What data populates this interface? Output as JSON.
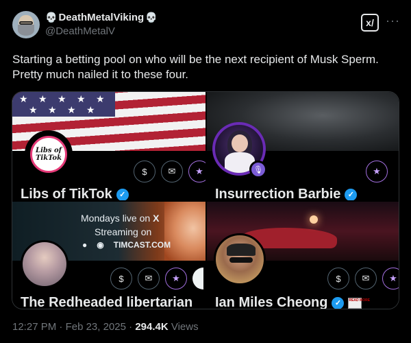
{
  "author": {
    "display_name": "DeathMetalViking",
    "handle": "@DeathMetalV",
    "skull_glyph": "💀"
  },
  "post": {
    "text": "Starting a betting pool on who will be the next recipient of Musk Sperm. Pretty much nailed it to these four."
  },
  "cards": [
    {
      "name": "Libs of TikTok",
      "pfp_text": "Libs of TikTok"
    },
    {
      "name": "Insurrection Barbie"
    },
    {
      "name": "The Redheaded libertarian",
      "banner_line1": "Mondays live on",
      "banner_x": "X",
      "banner_line2": "Streaming on",
      "banner_site": "TIMCAST.COM"
    },
    {
      "name": "Ian Miles Cheong",
      "badge_text": "READ MORE"
    }
  ],
  "meta": {
    "time": "12:27 PM",
    "separator": "·",
    "date": "Feb 23, 2025",
    "views_count": "294.4K",
    "views_label": "Views"
  },
  "icons": {
    "grok": "grok-icon",
    "more": "more-icon",
    "verified": "verified-icon"
  },
  "colors": {
    "background": "#000000",
    "text": "#e7e9ea",
    "muted": "#71767b",
    "verified": "#1d9bf0",
    "subscribe_accent": "#a36fe0"
  }
}
